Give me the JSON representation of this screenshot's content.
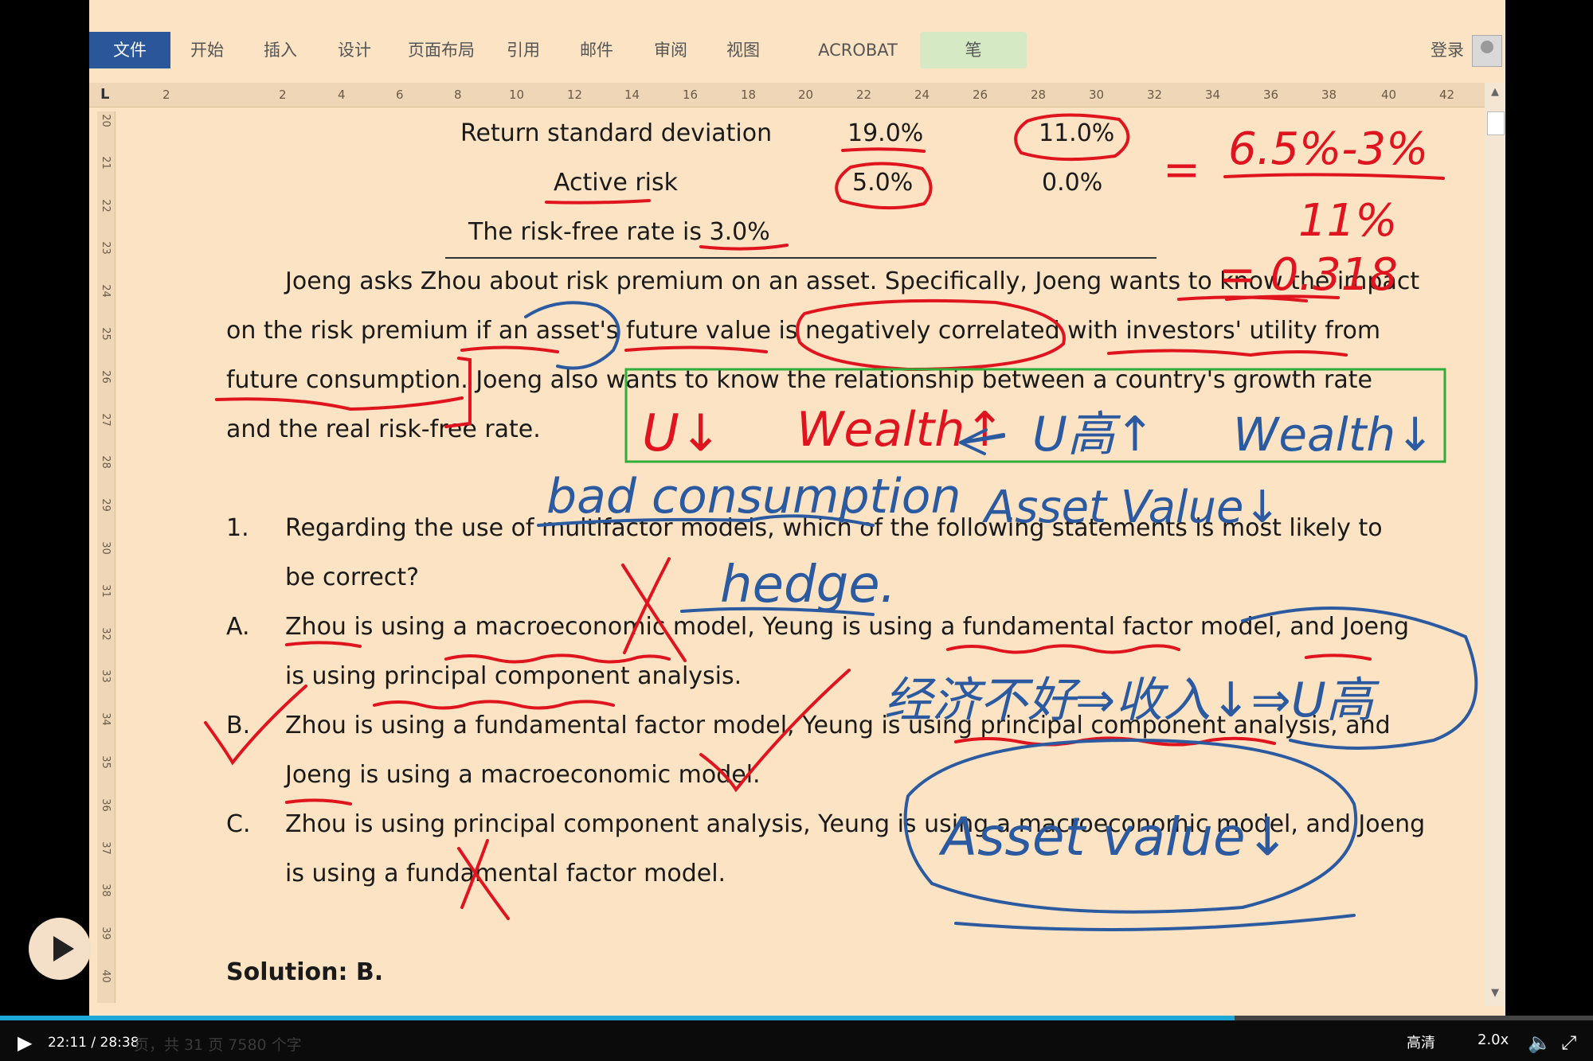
{
  "ribbon": {
    "tabs": [
      "文件",
      "开始",
      "插入",
      "设计",
      "页面布局",
      "引用",
      "邮件",
      "审阅",
      "视图",
      "ACROBAT",
      "笔"
    ],
    "login": "登录"
  },
  "ruler": {
    "corner": "L",
    "horizontal": [
      "2",
      "2",
      "4",
      "6",
      "8",
      "10",
      "12",
      "14",
      "16",
      "18",
      "20",
      "22",
      "24",
      "26",
      "28",
      "30",
      "32",
      "34",
      "36",
      "38",
      "40",
      "42"
    ],
    "vertical": [
      "20",
      "21",
      "22",
      "23",
      "24",
      "25",
      "26",
      "27",
      "28",
      "29",
      "30",
      "31",
      "32",
      "33",
      "34",
      "35",
      "36",
      "37",
      "38",
      "39",
      "40"
    ]
  },
  "table": {
    "row1_label": "Return standard deviation",
    "row1_v1": "19.0%",
    "row1_v2": "11.0%",
    "row2_label": "Active risk",
    "row2_v1": "5.0%",
    "row2_v2": "0.0%",
    "note": "The risk-free rate is 3.0%"
  },
  "para": {
    "l1": "Joeng asks Zhou about risk premium on an asset. Specifically, Joeng wants to know the impact",
    "l2": "on the risk premium if an asset's future value is negatively correlated with investors' utility from",
    "l3": "future consumption. Joeng also wants to know the relationship between a country's growth rate",
    "l4": "and the real risk-free rate."
  },
  "question": {
    "num": "1.",
    "q1": "Regarding the use of multifactor models, which of the following statements is most likely to",
    "q2": "be correct?",
    "a_letter": "A.",
    "a1": "Zhou is using a macroeconomic model, Yeung is using a fundamental factor model, and Joeng",
    "a2": "is using principal component analysis.",
    "b_letter": "B.",
    "b1": "Zhou is using a fundamental factor model, Yeung is using principal component analysis, and",
    "b2": "Joeng is using a macroeconomic model.",
    "c_letter": "C.",
    "c1": "Zhou is using principal component analysis, Yeung is using a macroeconomic model, and Joeng",
    "c2": "is using a fundamental factor model.",
    "solution": "Solution: B."
  },
  "handwriting": {
    "formula_num": "6.5%-3%",
    "formula_den": "11%",
    "formula_eq": "=",
    "formula_result": "= 0.318",
    "u_low": "U↓",
    "wealth_up": "Wealth↑",
    "u_high": "U高↑",
    "wealth_down": "Wealth↓",
    "bad_consumption": "bad consumption",
    "asset_value_down_1": "Asset Value↓",
    "hedge": "hedge.",
    "chain": "经济不好⇒收入↓⇒U高",
    "asset_value_down_2": "Asset value↓"
  },
  "player": {
    "time": "22:11 / 28:38",
    "quality": "高清",
    "speed": "2.0x",
    "progress": 0.775
  },
  "status": {
    "text": "页，共 31 页   7580 个字"
  },
  "colors": {
    "page": "#fbe3c3",
    "red_ink": "#e0141e",
    "blue_ink": "#2c5aa0",
    "box": "#2fae3a",
    "ribbon_file": "#2b579a"
  }
}
